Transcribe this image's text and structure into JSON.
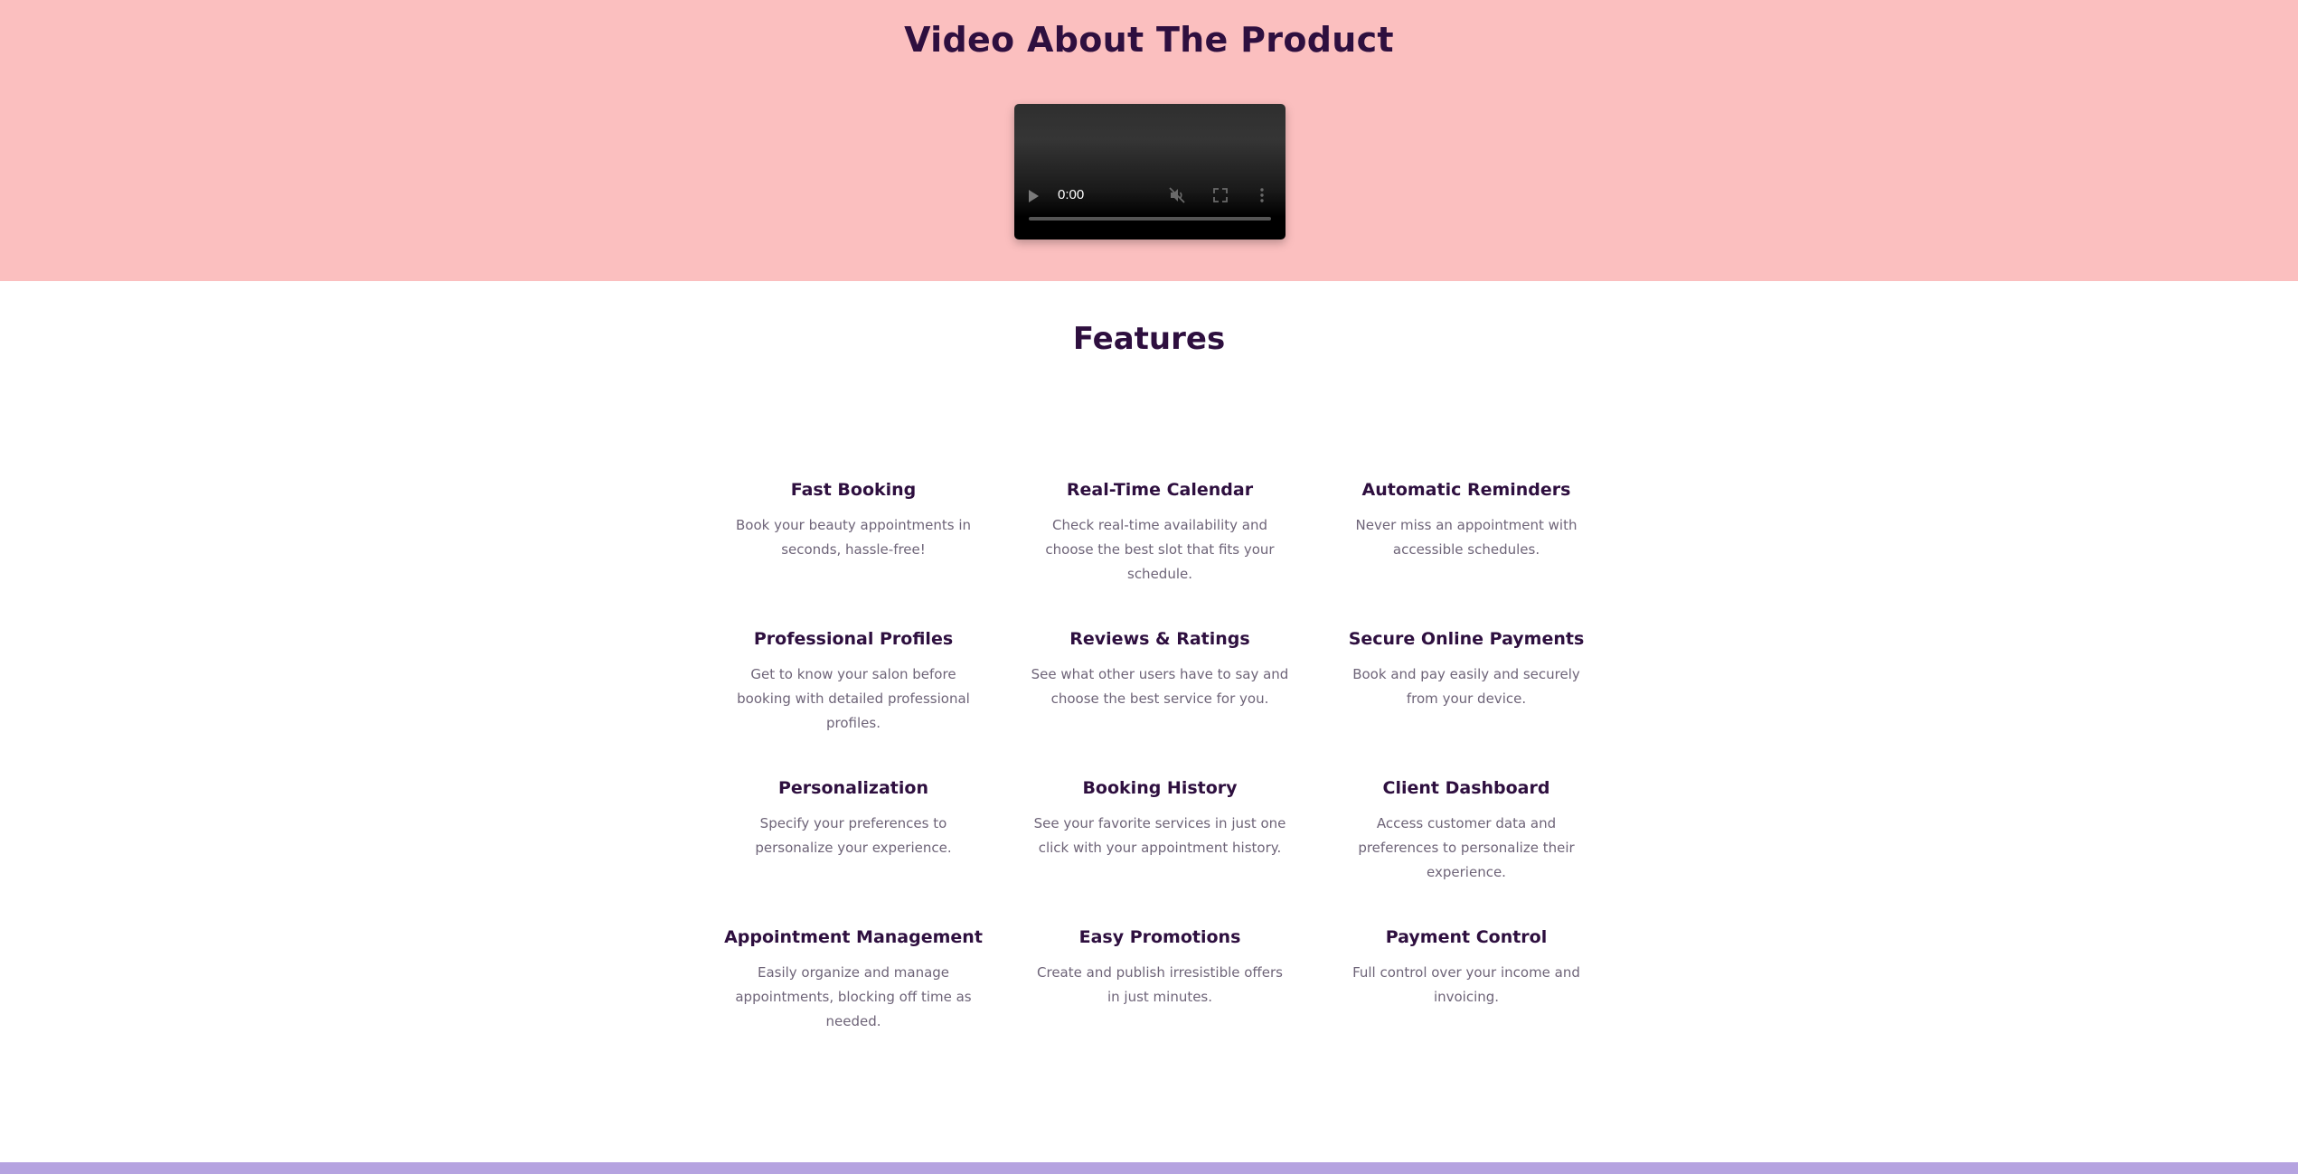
{
  "video_section": {
    "title": "Video About The Product",
    "background_color": "#fbbfbf",
    "player": {
      "time": "0:00",
      "progress": 0,
      "icons": {
        "play": "play-icon",
        "mute": "muted-speaker-icon",
        "fullscreen": "fullscreen-icon",
        "more": "more-options-icon"
      }
    }
  },
  "features": {
    "title": "Features",
    "items": [
      {
        "title": "Fast Booking",
        "description": "Book your beauty appointments in seconds, hassle-free!"
      },
      {
        "title": "Real-Time Calendar",
        "description": "Check real-time availability and choose the best slot that fits your schedule."
      },
      {
        "title": "Automatic Reminders",
        "description": "Never miss an appointment with accessible schedules."
      },
      {
        "title": "Professional Profiles",
        "description": "Get to know your salon before booking with detailed professional profiles."
      },
      {
        "title": "Reviews & Ratings",
        "description": "See what other users have to say and choose the best service for you."
      },
      {
        "title": "Secure Online Payments",
        "description": "Book and pay easily and securely from your device."
      },
      {
        "title": "Personalization",
        "description": "Specify your preferences to personalize your experience."
      },
      {
        "title": "Booking History",
        "description": "See your favorite services in just one click with your appointment history."
      },
      {
        "title": "Client Dashboard",
        "description": "Access customer data and preferences to personalize their experience."
      },
      {
        "title": "Appointment Management",
        "description": "Easily organize and manage appointments, blocking off time as needed."
      },
      {
        "title": "Easy Promotions",
        "description": "Create and publish irresistible offers in just minutes."
      },
      {
        "title": "Payment Control",
        "description": "Full control over your income and invoicing."
      }
    ]
  },
  "colors": {
    "heading": "#2e0f3f",
    "body_text": "#6e6478",
    "footer_bar": "#b5a3e0"
  }
}
